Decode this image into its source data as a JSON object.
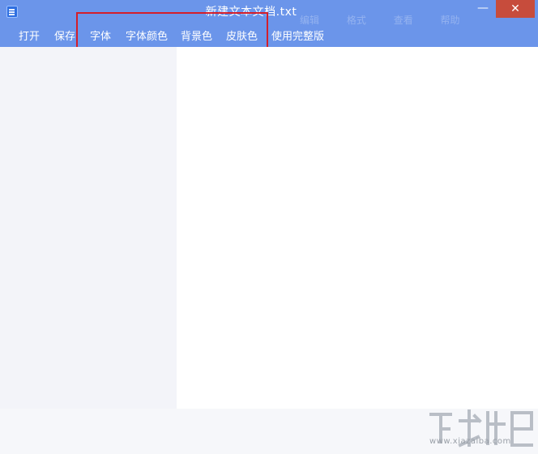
{
  "window": {
    "title": "新建文本文档.txt",
    "minimize_glyph": "—",
    "close_glyph": "✕"
  },
  "ghost_menu": [
    "编辑",
    "格式",
    "查看",
    "帮助"
  ],
  "menu": {
    "items": [
      {
        "label": "打开"
      },
      {
        "label": "保存"
      },
      {
        "label": "字体"
      },
      {
        "label": "字体颜色"
      },
      {
        "label": "背景色"
      },
      {
        "label": "皮肤色"
      },
      {
        "label": "使用完整版"
      }
    ]
  },
  "editor": {
    "value": ""
  },
  "watermark": {
    "text": "www.xiazaiba.com"
  },
  "colors": {
    "titlebar": "#6b95ea",
    "close_button": "#c74c3c",
    "highlight": "#d41e2a"
  },
  "icons": {
    "app": "notepad-icon",
    "minimize": "minimize-icon",
    "close": "close-icon"
  }
}
